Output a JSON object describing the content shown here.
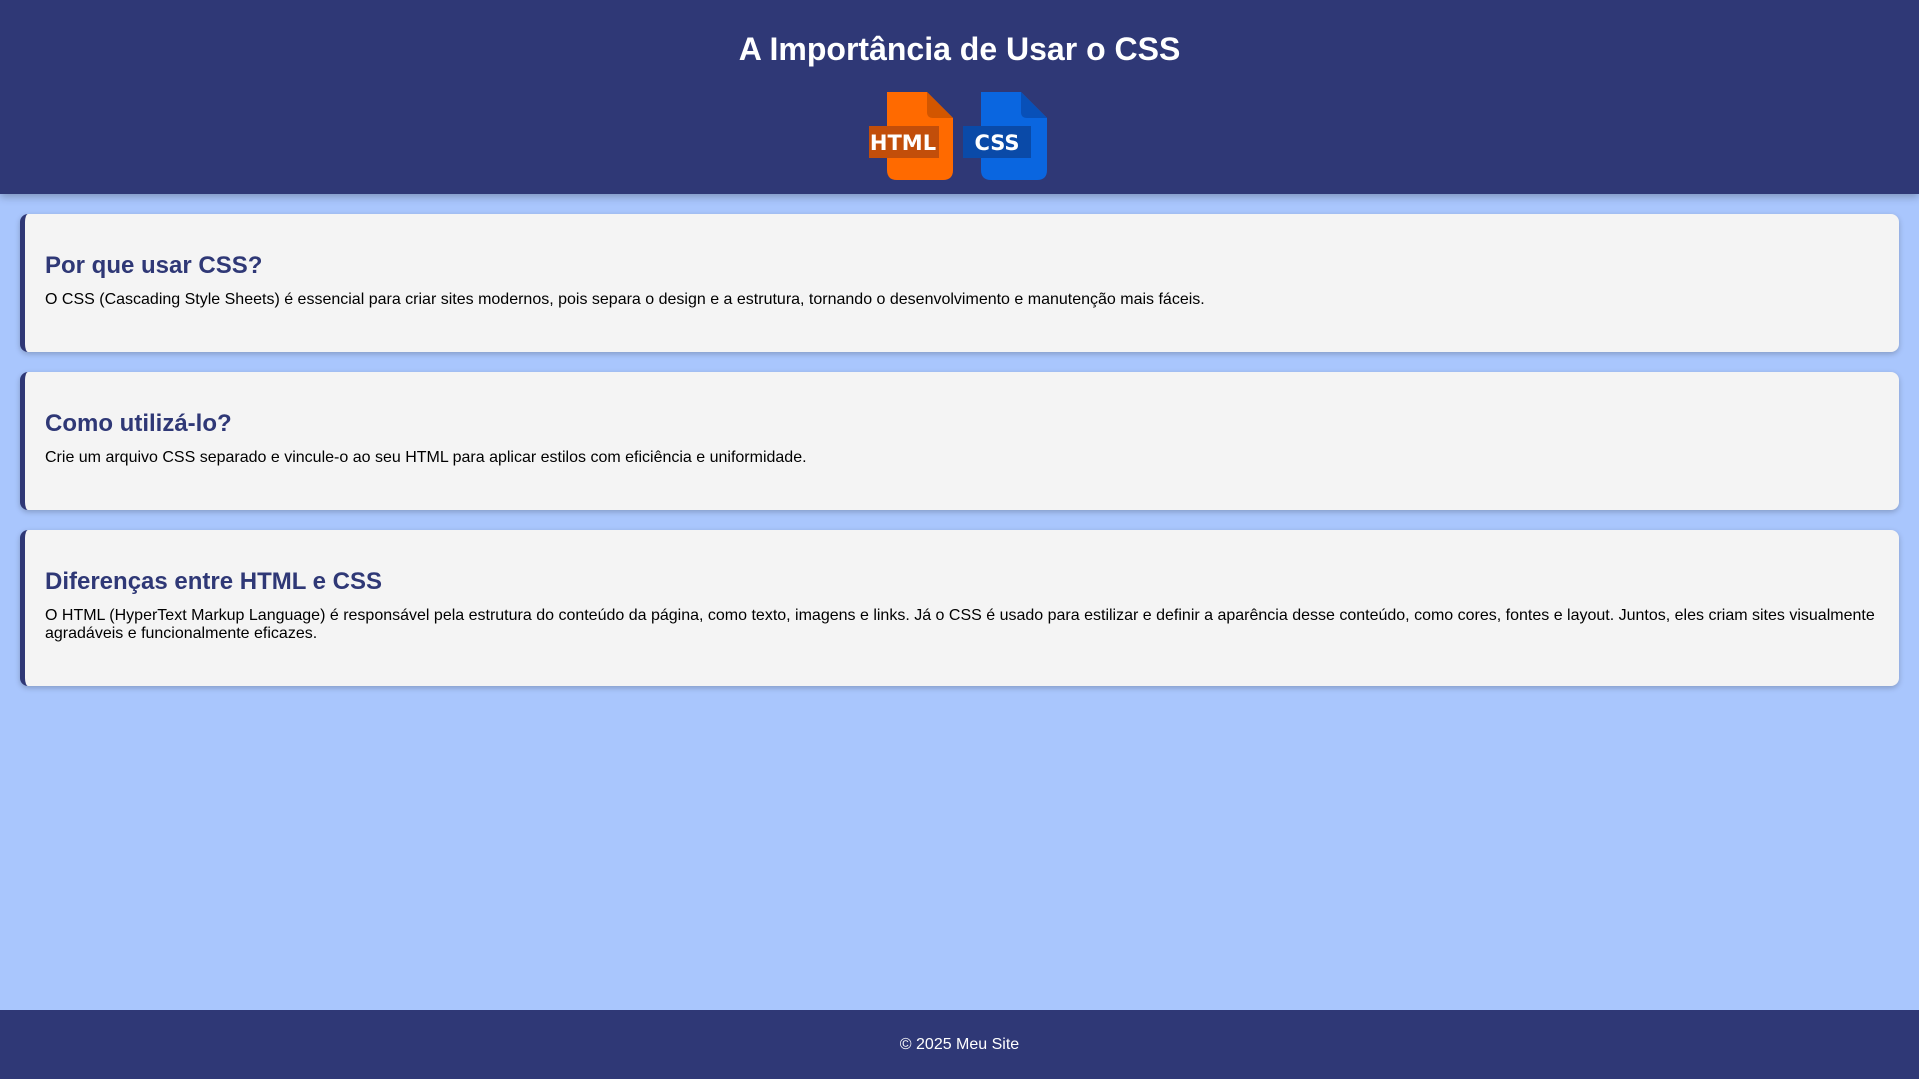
{
  "header": {
    "title": "A Importância de Usar o CSS",
    "logos": [
      {
        "label": "HTML",
        "icon": "html-file-icon",
        "color": "#ff6a00",
        "fold_color": "#d25600",
        "badge_color": "#c24e0a"
      },
      {
        "label": "CSS",
        "icon": "css-file-icon",
        "color": "#0a66e0",
        "fold_color": "#0850b8",
        "badge_color": "#0a4aa8"
      }
    ]
  },
  "sections": [
    {
      "title": "Por que usar CSS?",
      "text": "O CSS (Cascading Style Sheets) é essencial para criar sites modernos, pois separa o design e a estrutura, tornando o desenvolvimento e manutenção mais fáceis."
    },
    {
      "title": "Como utilizá-lo?",
      "text": "Crie um arquivo CSS separado e vincule-o ao seu HTML para aplicar estilos com eficiência e uniformidade."
    },
    {
      "title": "Diferenças entre HTML e CSS",
      "text": "O HTML (HyperText Markup Language) é responsável pela estrutura do conteúdo da página, como texto, imagens e links. Já o CSS é usado para estilizar e definir a aparência desse conteúdo, como cores, fontes e layout. Juntos, eles criam sites visualmente agradáveis e funcionalmente eficazes."
    }
  ],
  "footer": {
    "text": "© 2025 Meu Site"
  },
  "colors": {
    "background": "#a9c6fd",
    "header": "#2f3876",
    "card": "#f4f4f4",
    "heading": "#2f3876"
  }
}
